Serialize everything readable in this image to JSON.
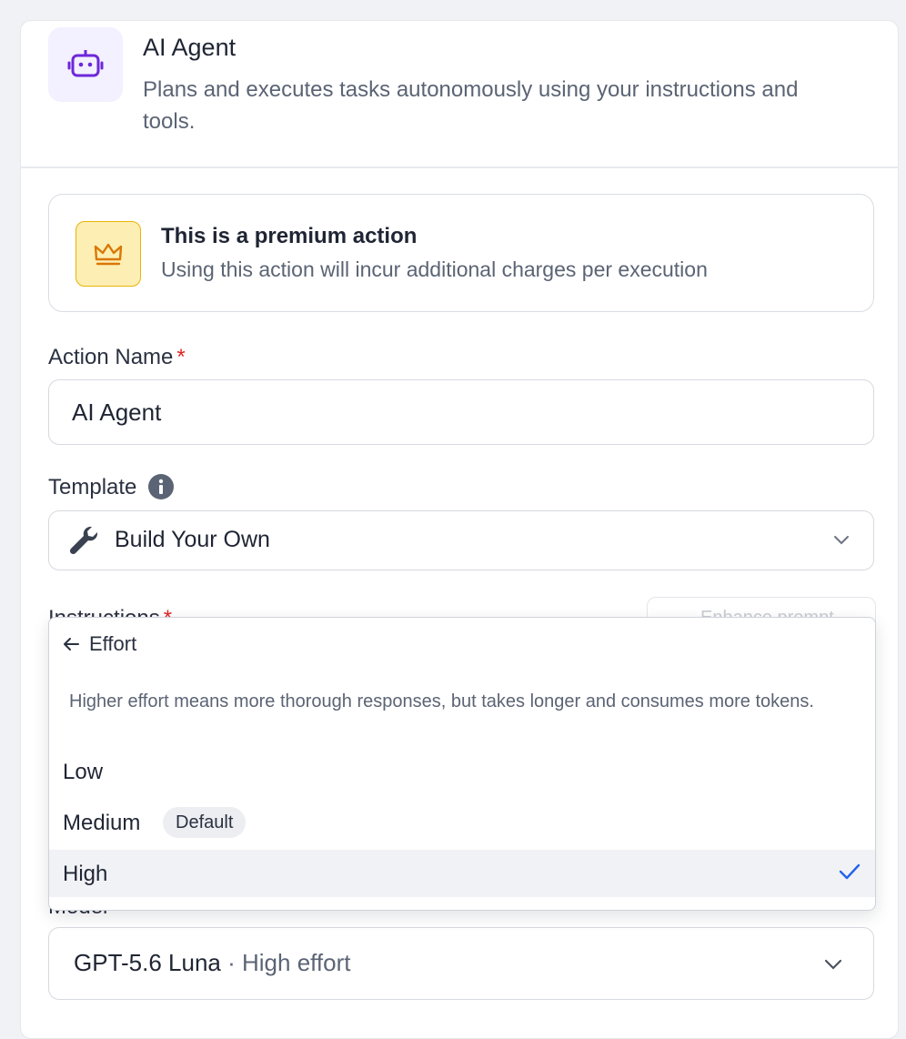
{
  "header": {
    "title": "AI Agent",
    "subtitle": "Plans and executes tasks autonomously using your instructions and tools."
  },
  "premium": {
    "title": "This is a premium action",
    "description": "Using this action will incur additional charges per execution"
  },
  "action_name": {
    "label": "Action Name",
    "required_mark": "*",
    "value": "AI Agent"
  },
  "template": {
    "label": "Template",
    "value": "Build Your Own"
  },
  "instructions": {
    "label": "Instructions",
    "required_mark": "*",
    "enhance_label": "Enhance prompt"
  },
  "effort_menu": {
    "back_label": "Effort",
    "description": "Higher effort means more thorough responses, but takes longer and consumes more tokens.",
    "options": [
      {
        "label": "Low"
      },
      {
        "label": "Medium",
        "badge": "Default"
      },
      {
        "label": "High",
        "selected": true
      }
    ]
  },
  "model": {
    "label": "Model",
    "name": "GPT-5.6 Luna",
    "separator": " · ",
    "effort": "High effort"
  },
  "colors": {
    "accent": "#6d28d9",
    "required": "#dc2626",
    "check": "#2563eb",
    "premium_bg": "#fdefb3"
  },
  "icons": [
    "robot-icon",
    "crown-icon",
    "info-icon",
    "wrench-icon",
    "chevron-down-icon",
    "arrow-left-icon",
    "check-icon",
    "sparkle-icon"
  ]
}
